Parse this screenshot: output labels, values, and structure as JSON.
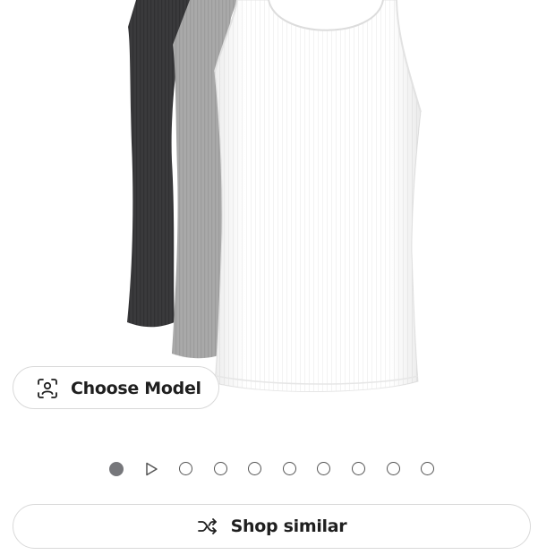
{
  "product": {
    "image_alt": "Tank tops in black, gray and white",
    "colors": {
      "black_tank": "#38383a",
      "gray_tank": "#a9a9a9",
      "white_tank": "#ffffff"
    }
  },
  "choose_model": {
    "label": "Choose Model",
    "icon": "person-scan-icon"
  },
  "pager": {
    "total": 10,
    "active_index": 0,
    "video_index": 1,
    "colors": {
      "active": "#76777b",
      "inactive_border": "#555555"
    }
  },
  "shop_similar": {
    "label": "Shop similar",
    "icon": "shuffle-icon"
  }
}
